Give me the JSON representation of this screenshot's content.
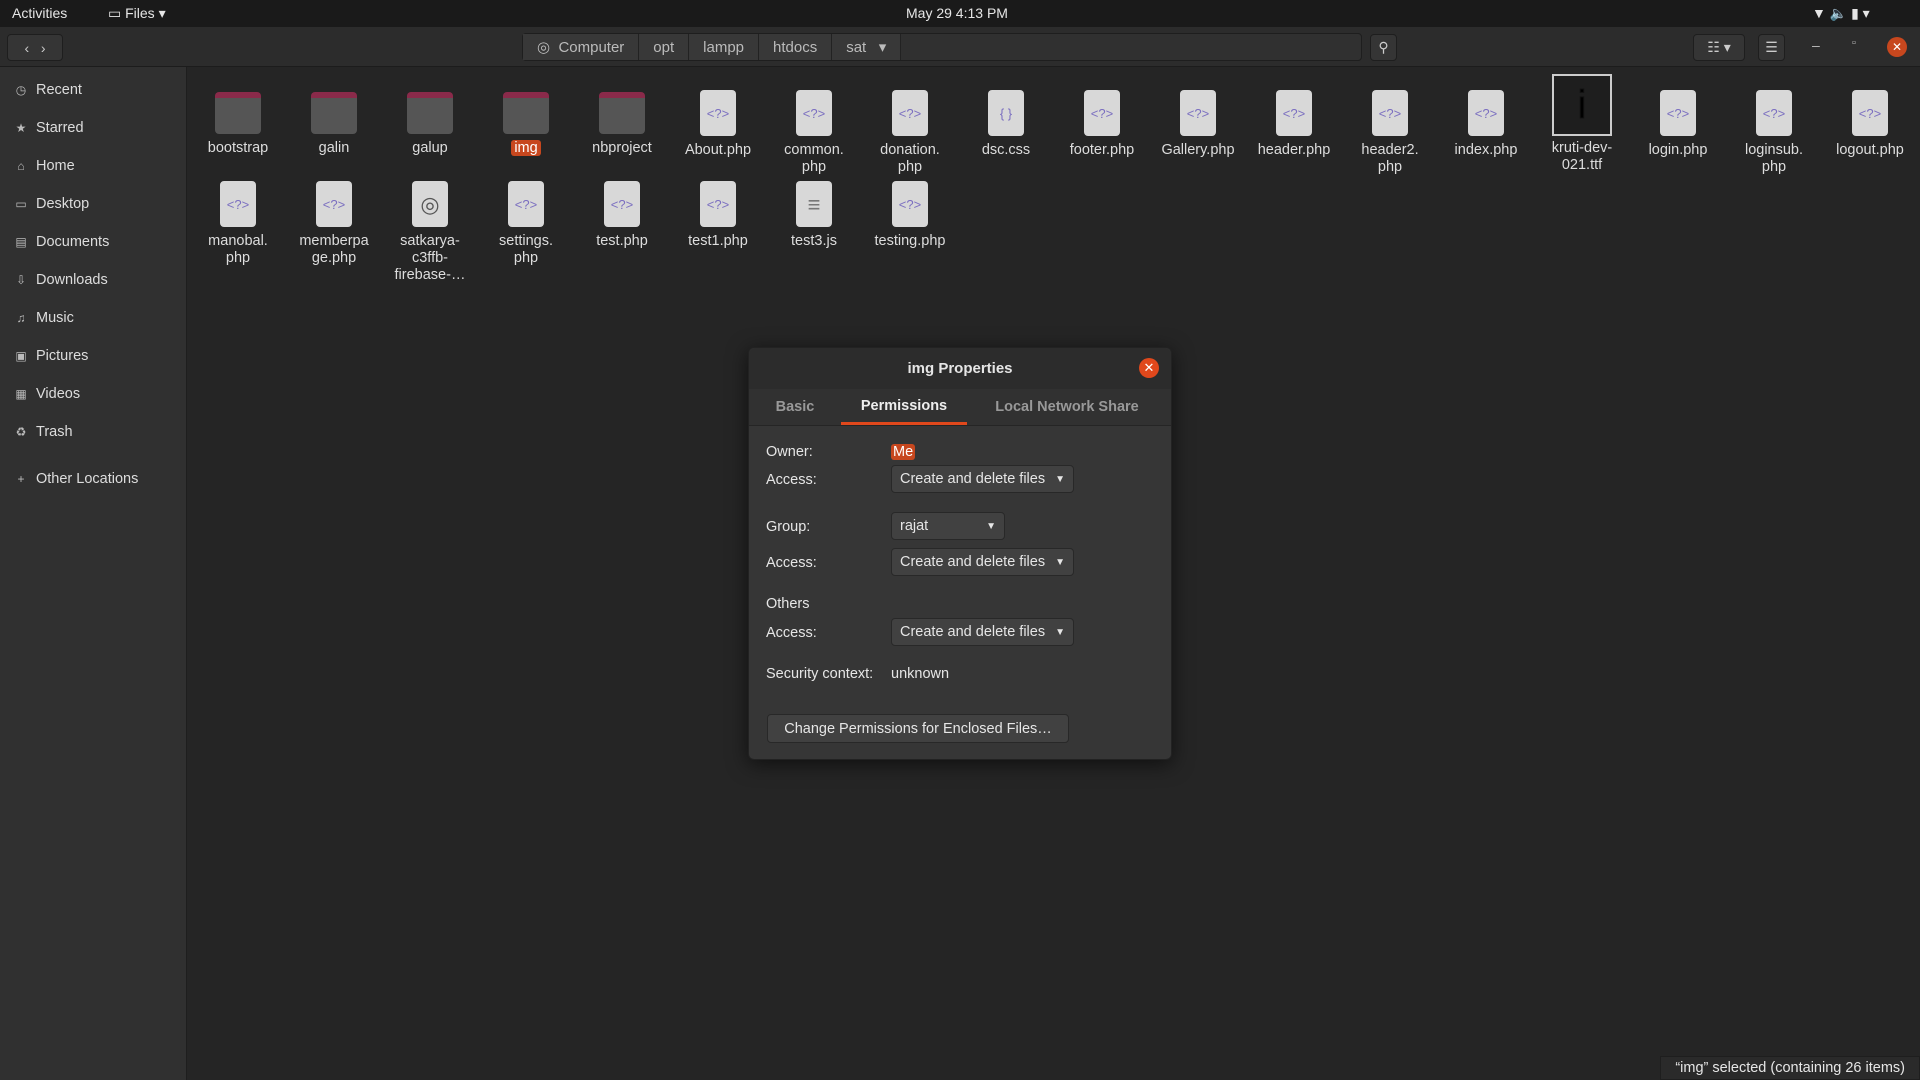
{
  "topbar": {
    "activities": "Activities",
    "app": "Files",
    "clock": "May 29  4:13 PM"
  },
  "header": {
    "path": [
      "Computer",
      "opt",
      "lampp",
      "htdocs",
      "sat"
    ]
  },
  "sidebar": {
    "items": [
      {
        "label": "Recent",
        "icon": "clock-icon"
      },
      {
        "label": "Starred",
        "icon": "star-icon"
      },
      {
        "label": "Home",
        "icon": "home-icon"
      },
      {
        "label": "Desktop",
        "icon": "desktop-icon"
      },
      {
        "label": "Documents",
        "icon": "document-icon"
      },
      {
        "label": "Downloads",
        "icon": "download-icon"
      },
      {
        "label": "Music",
        "icon": "music-icon"
      },
      {
        "label": "Pictures",
        "icon": "picture-icon"
      },
      {
        "label": "Videos",
        "icon": "video-icon"
      },
      {
        "label": "Trash",
        "icon": "trash-icon"
      }
    ],
    "other": "Other Locations"
  },
  "files": [
    {
      "name": "bootstrap",
      "type": "folder"
    },
    {
      "name": "galin",
      "type": "folder"
    },
    {
      "name": "galup",
      "type": "folder"
    },
    {
      "name": "img",
      "type": "folder",
      "selected": true
    },
    {
      "name": "nbproject",
      "type": "folder"
    },
    {
      "name": "About.php",
      "type": "php"
    },
    {
      "name": "common.\nphp",
      "type": "php"
    },
    {
      "name": "donation.\nphp",
      "type": "php"
    },
    {
      "name": "dsc.css",
      "type": "css"
    },
    {
      "name": "footer.php",
      "type": "php"
    },
    {
      "name": "Gallery.php",
      "type": "php"
    },
    {
      "name": "header.php",
      "type": "php"
    },
    {
      "name": "header2.\nphp",
      "type": "php"
    },
    {
      "name": "index.php",
      "type": "php"
    },
    {
      "name": "kruti-dev-\n021.ttf",
      "type": "font"
    },
    {
      "name": "login.php",
      "type": "php"
    },
    {
      "name": "loginsub.\nphp",
      "type": "php"
    },
    {
      "name": "logout.php",
      "type": "php"
    },
    {
      "name": "manobal.\nphp",
      "type": "php"
    },
    {
      "name": "memberpa\nge.php",
      "type": "php"
    },
    {
      "name": "satkarya-\nc3ffb-\nfirebase-…",
      "type": "json"
    },
    {
      "name": "settings.\nphp",
      "type": "php"
    },
    {
      "name": "test.php",
      "type": "php"
    },
    {
      "name": "test1.php",
      "type": "php"
    },
    {
      "name": "test3.js",
      "type": "js"
    },
    {
      "name": "testing.php",
      "type": "php"
    }
  ],
  "dialog": {
    "title": "img Properties",
    "tabs": [
      "Basic",
      "Permissions",
      "Local Network Share"
    ],
    "owner_label": "Owner:",
    "owner": "Me",
    "access_label": "Access:",
    "owner_access": "Create and delete files",
    "group_label": "Group:",
    "group": "rajat",
    "group_access": "Create and delete files",
    "others_label": "Others",
    "others_access": "Create and delete files",
    "security_label": "Security context:",
    "security": "unknown",
    "change_button": "Change Permissions for Enclosed Files…"
  },
  "status": "“img” selected  (containing 26 items)",
  "colors": {
    "accent": "#e0481c"
  }
}
